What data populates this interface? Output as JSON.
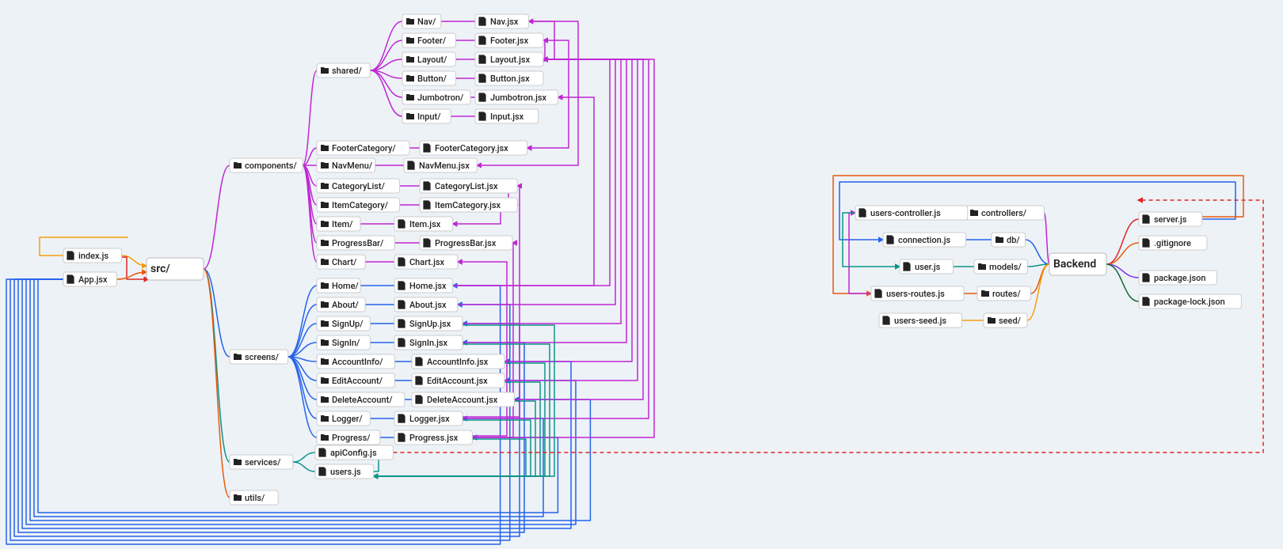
{
  "colors": {
    "purple": "#c026d3",
    "blue": "#2563eb",
    "teal": "#0d9488",
    "orange": "#ea580c",
    "red": "#dc2626",
    "amber": "#f59e0b",
    "darkgreen": "#166534",
    "violet": "#7c3aed"
  },
  "front_root": "src/",
  "back_root": "Backend",
  "nodes": {
    "indexjs": "index.js",
    "appjsx": "App.jsx",
    "components": "components/",
    "screens": "screens/",
    "services": "services/",
    "utils": "utils/",
    "shared": "shared/",
    "footercategory": "FooterCategory/",
    "navmenu": "NavMenu/",
    "categorylist": "CategoryList/",
    "itemcategory": "ItemCategory/",
    "item": "Item/",
    "progressbar": "ProgressBar/",
    "chart": "Chart/",
    "nav": "Nav/",
    "footer": "Footer/",
    "layout": "Layout/",
    "button": "Button/",
    "jumbotron": "Jumbotron/",
    "input": "Input/",
    "navjsx": "Nav.jsx",
    "footerjsx": "Footer.jsx",
    "layoutjsx": "Layout.jsx",
    "buttonjsx": "Button.jsx",
    "jumbotronjsx": "Jumbotron.jsx",
    "inputjsx": "Input.jsx",
    "footercategoryjsx": "FooterCategory.jsx",
    "navmenujsx": "NavMenu.jsx",
    "categorylistjsx": "CategoryList.jsx",
    "itemcategoryjsx": "ItemCategory.jsx",
    "itemjsx": "Item.jsx",
    "progressbarjsx": "ProgressBar.jsx",
    "chartjsx": "Chart.jsx",
    "home": "Home/",
    "about": "About/",
    "signup": "SignUp/",
    "signin": "SignIn/",
    "accountinfo": "AccountInfo/",
    "editaccount": "EditAccount/",
    "deleteaccount": "DeleteAccount/",
    "logger": "Logger/",
    "progress": "Progress/",
    "homejsx": "Home.jsx",
    "aboutjsx": "About.jsx",
    "signupjsx": "SignUp.jsx",
    "signinjsx": "SignIn.jsx",
    "accountinfojsx": "AccountInfo.jsx",
    "editaccountjsx": "EditAccount.jsx",
    "deleteaccountjsx": "DeleteAccount.jsx",
    "loggerjsx": "Logger.jsx",
    "progressjsx": "Progress.jsx",
    "apiconfig": "apiConfig.js",
    "usersjs": "users.js",
    "controllers": "controllers/",
    "db": "db/",
    "models": "models/",
    "routes": "routes/",
    "seed": "seed/",
    "userscontroller": "users-controller.js",
    "connection": "connection.js",
    "userjs": "user.js",
    "usersroutes": "users-routes.js",
    "usersseed": "users-seed.js",
    "serverjs": "server.js",
    "gitignore": ".gitignore",
    "packagejson": "package.json",
    "packagelock": "package-lock.json"
  }
}
